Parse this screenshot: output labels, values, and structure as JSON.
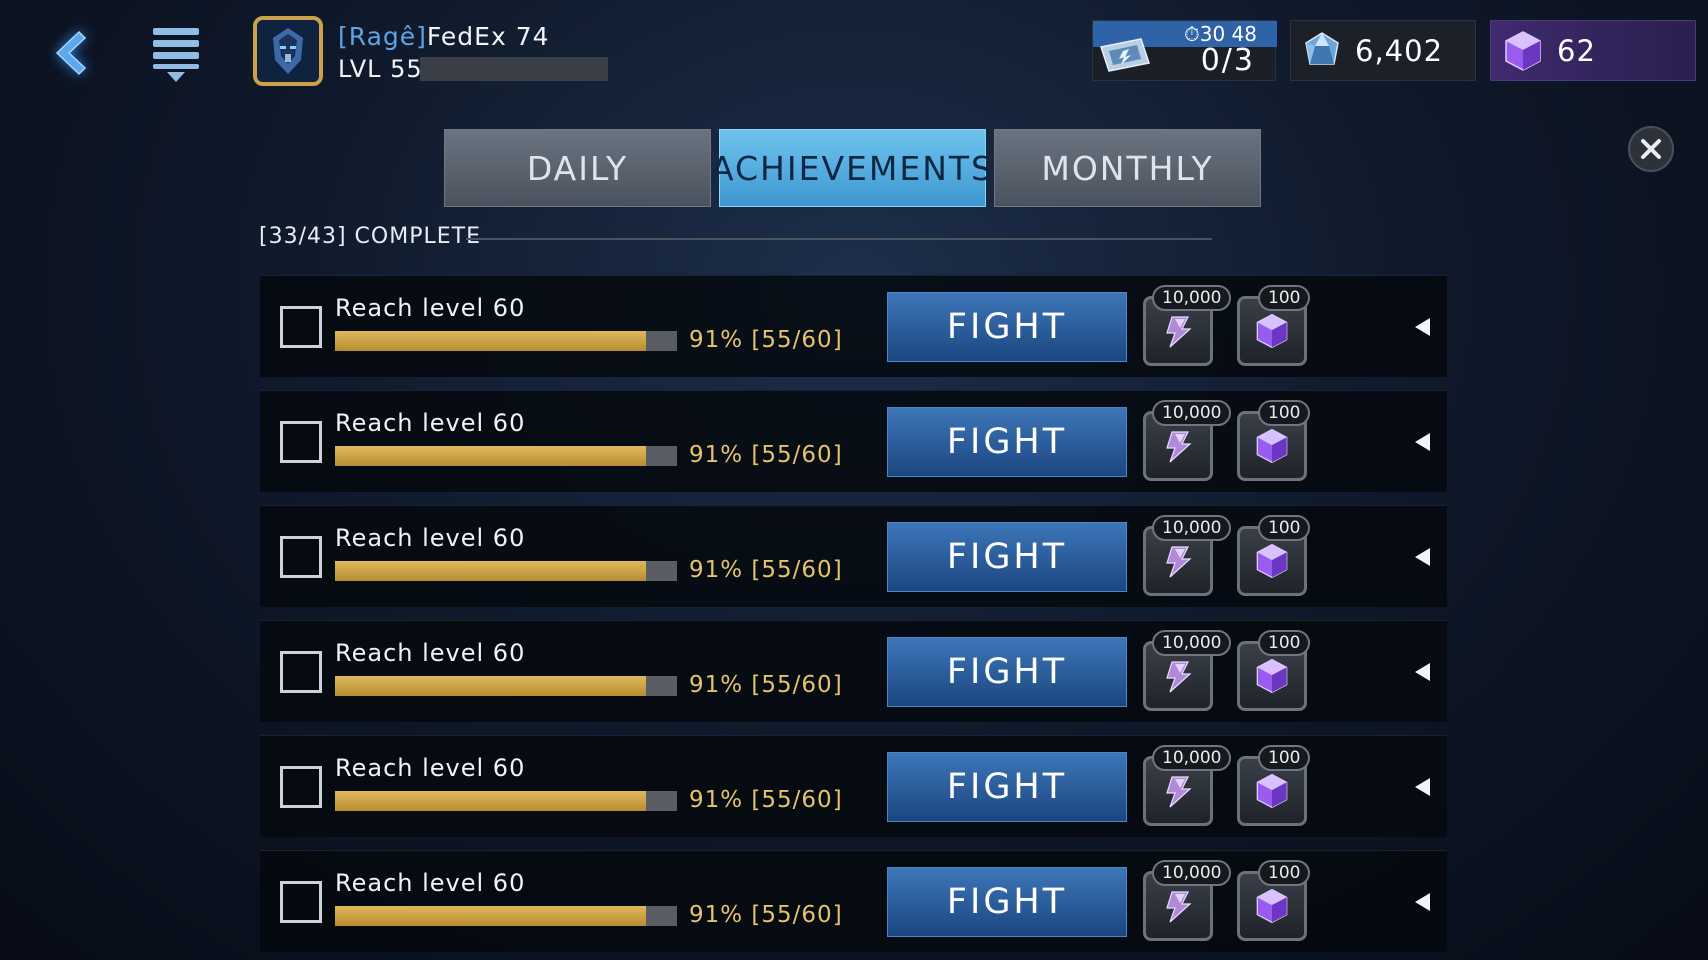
{
  "header": {
    "player_tag": "[Ragê]",
    "player_name": "FedEx 74",
    "level_label": "LVL 55",
    "xp_progress": 0.0
  },
  "energy": {
    "timer": "⏱30 48",
    "count": "0/3"
  },
  "currencies": {
    "crystals": "6,402",
    "gems": "62"
  },
  "tabs": [
    {
      "label": "DAILY",
      "active": false
    },
    {
      "label": "ACHIEVEMENTS",
      "active": true
    },
    {
      "label": "MONTHLY",
      "active": false
    }
  ],
  "summary": "[33/43] COMPLETE",
  "achievements": [
    {
      "title": "Reach level 60",
      "progress": 0.91,
      "progress_text": "91% [55/60]",
      "action": "FIGHT",
      "reward_1": "10,000",
      "reward_2": "100"
    },
    {
      "title": "Reach level 60",
      "progress": 0.91,
      "progress_text": "91% [55/60]",
      "action": "FIGHT",
      "reward_1": "10,000",
      "reward_2": "100"
    },
    {
      "title": "Reach level 60",
      "progress": 0.91,
      "progress_text": "91% [55/60]",
      "action": "FIGHT",
      "reward_1": "10,000",
      "reward_2": "100"
    },
    {
      "title": "Reach level 60",
      "progress": 0.91,
      "progress_text": "91% [55/60]",
      "action": "FIGHT",
      "reward_1": "10,000",
      "reward_2": "100"
    },
    {
      "title": "Reach level 60",
      "progress": 0.91,
      "progress_text": "91% [55/60]",
      "action": "FIGHT",
      "reward_1": "10,000",
      "reward_2": "100"
    },
    {
      "title": "Reach level 60",
      "progress": 0.91,
      "progress_text": "91% [55/60]",
      "action": "FIGHT",
      "reward_1": "10,000",
      "reward_2": "100"
    }
  ],
  "colors": {
    "accent_tab": "#4fa7dc",
    "progress_gold": "#d3a747",
    "fight_button": "#2a5a9a",
    "gem_purple": "#9a5cf0"
  },
  "icons": {
    "back": "chevron-left-icon",
    "menu": "hamburger-menu-icon",
    "close": "close-icon",
    "energy": "energy-ticket-icon",
    "crystal": "crystal-icon",
    "gem": "purple-gem-icon",
    "reward_credits": "credits-token-icon",
    "expand": "triangle-left-icon"
  }
}
